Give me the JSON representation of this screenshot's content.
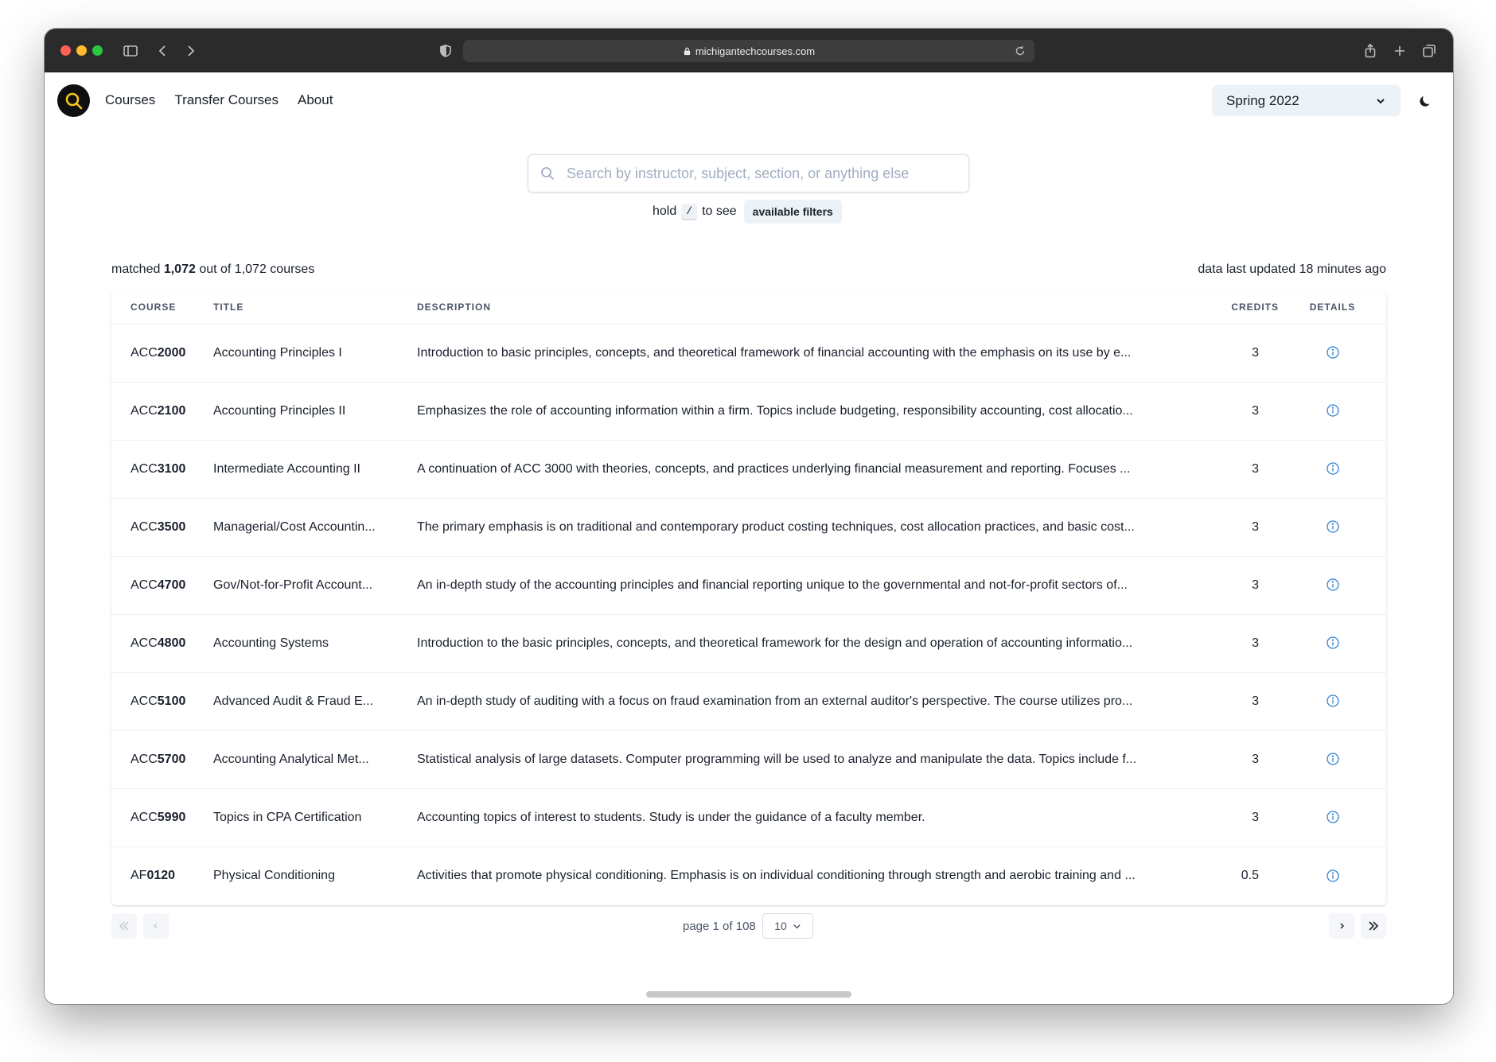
{
  "browser": {
    "url": "michigantechcourses.com"
  },
  "nav": {
    "links": [
      "Courses",
      "Transfer Courses",
      "About"
    ],
    "semester": "Spring 2022"
  },
  "search": {
    "placeholder": "Search by instructor, subject, section, or anything else",
    "hint_prefix": "hold",
    "hint_key": "/",
    "hint_middle": "to see",
    "filters_label": "available filters"
  },
  "summary": {
    "matched_prefix": "matched",
    "matched_count": "1,072",
    "matched_suffix": "out of 1,072 courses",
    "updated": "data last updated 18 minutes ago"
  },
  "table": {
    "headers": [
      "Course",
      "Title",
      "Description",
      "Credits",
      "Details"
    ],
    "rows": [
      {
        "subject": "ACC",
        "number": "2000",
        "title": "Accounting Principles I",
        "description": "Introduction to basic principles, concepts, and theoretical framework of financial accounting with the emphasis on its use by e...",
        "credits": "3"
      },
      {
        "subject": "ACC",
        "number": "2100",
        "title": "Accounting Principles II",
        "description": "Emphasizes the role of accounting information within a firm. Topics include budgeting, responsibility accounting, cost allocatio...",
        "credits": "3"
      },
      {
        "subject": "ACC",
        "number": "3100",
        "title": "Intermediate Accounting II",
        "description": "A continuation of ACC 3000 with theories, concepts, and practices underlying financial measurement and reporting. Focuses ...",
        "credits": "3"
      },
      {
        "subject": "ACC",
        "number": "3500",
        "title": "Managerial/Cost Accountin...",
        "description": "The primary emphasis is on traditional and contemporary product costing techniques, cost allocation practices, and basic cost...",
        "credits": "3"
      },
      {
        "subject": "ACC",
        "number": "4700",
        "title": "Gov/Not-for-Profit Account...",
        "description": "An in-depth study of the accounting principles and financial reporting unique to the governmental and not-for-profit sectors of...",
        "credits": "3"
      },
      {
        "subject": "ACC",
        "number": "4800",
        "title": "Accounting Systems",
        "description": "Introduction to the basic principles, concepts, and theoretical framework for the design and operation of accounting informatio...",
        "credits": "3"
      },
      {
        "subject": "ACC",
        "number": "5100",
        "title": "Advanced Audit & Fraud E...",
        "description": "An in-depth study of auditing with a focus on fraud examination from an external auditor's perspective. The course utilizes pro...",
        "credits": "3"
      },
      {
        "subject": "ACC",
        "number": "5700",
        "title": "Accounting Analytical Met...",
        "description": "Statistical analysis of large datasets. Computer programming will be used to analyze and manipulate the data. Topics include f...",
        "credits": "3"
      },
      {
        "subject": "ACC",
        "number": "5990",
        "title": "Topics in CPA Certification",
        "description": "Accounting topics of interest to students. Study is under the guidance of a faculty member.",
        "credits": "3"
      },
      {
        "subject": "AF",
        "number": "0120",
        "title": "Physical Conditioning",
        "description": "Activities that promote physical conditioning. Emphasis is on individual conditioning through strength and aerobic training and ...",
        "credits": "0.5"
      }
    ]
  },
  "pagination": {
    "info": "page 1 of 108",
    "page_size": "10"
  },
  "colors": {
    "accent": "#3182ce",
    "logo_ring": "#f5c518"
  }
}
